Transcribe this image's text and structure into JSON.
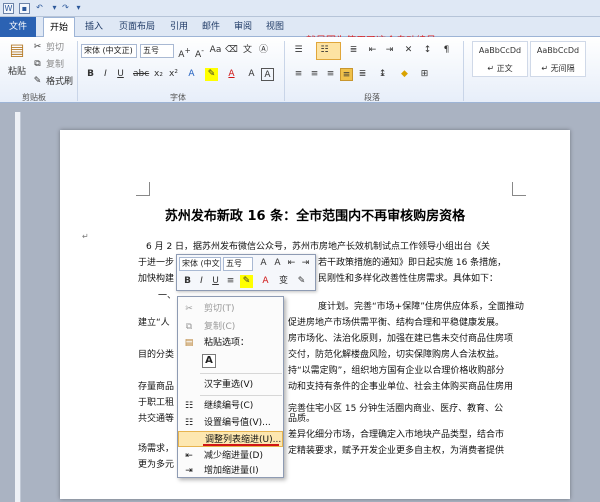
{
  "annotation": "就是因为使用了这个自动编号",
  "tabs": {
    "file": "文件",
    "items": [
      "开始",
      "插入",
      "页面布局",
      "引用",
      "邮件",
      "审阅",
      "视图"
    ]
  },
  "ribbon": {
    "paste": "粘贴",
    "cut": "剪切",
    "copy": "复制",
    "format_painter": "格式刷",
    "font_name": "宋体 (中文正)",
    "font_size": "五号",
    "group_clipboard": "剪贴板",
    "group_font": "字体",
    "group_paragraph": "段落",
    "style1_preview": "AaBbCcDd",
    "style1_name": "↵ 正文",
    "style2_preview": "AaBbCcDd",
    "style2_name": "↵ 无间隔"
  },
  "document": {
    "title": "苏州发布新政 16 条：全市范围内不再审核购房资格",
    "p1_line1": "6 月 2 日，据苏州发布微信公众号，苏州市房地产长效机制试点工作领导小组出台《关",
    "p1_line2": "于进一步",
    "p1_line2b": "若干政策措施的通知》即日起实施 16 条措施，",
    "p1_line3": "加快构建",
    "p1_line3b": "民刚性和多样化改善性住房需求。具体如下：",
    "p2_line1": "一、",
    "p3_line1": "度计划。完善“市场+保障”住房供应体系，全面推动",
    "p3_line2": "建立“人",
    "p3_line2b": "促进房地产市场供需平衡、结构合理和平稳健康发展。",
    "p4_line1": "房市场化、法治化原则，加强在建已售未交付商品住房项",
    "p4_line2": "目的分类",
    "p4_line2b": "交付，防范化解楼盘风险，切实保障购房人合法权益。",
    "p5_line1": "持“以需定购”，组织地方国有企业以合理价格收购部分",
    "p5_line2": "存量商品",
    "p5_line2b": "动和支持有条件的企事业单位、社会主体购买商品住房用",
    "p5_line3": "于职工租",
    "p6_line1": "完善住宅小区 15 分钟生活圈内商业、医疗、教育、公",
    "p6_line2": "共交通等",
    "p6_line2b": "品质。",
    "p7_line1": "差异化细分市场，合理确定入市地块产品类型，结合市",
    "p7_line2": "场需求，",
    "p7_line2b": "定精装要求，赋予开发企业更多自主权，为消费者提供",
    "p7_line3": "更为多元"
  },
  "mini_toolbar": {
    "font_name": "宋体 (中文",
    "font_size": "五号"
  },
  "context_menu": {
    "cut": "剪切(T)",
    "copy": "复制(C)",
    "paste_options": "粘贴选项：",
    "paste_keep": "A",
    "hanzi": "汉字重选(V)",
    "continue_numbering": "继续编号(C)",
    "set_number_value": "设置编号值(V)...",
    "adjust_indent": "调整列表缩进(U)...",
    "decrease_indent": "减少缩进量(D)",
    "increase_indent": "增加缩进量(I)"
  },
  "colors": {
    "file_tab": "#2b62b3",
    "annotation": "#e02020",
    "hover": "#fde7b0"
  }
}
